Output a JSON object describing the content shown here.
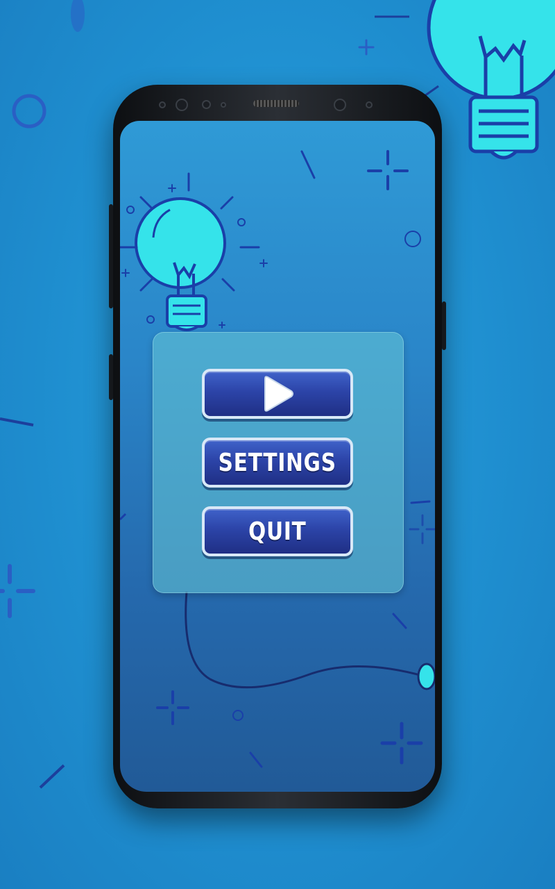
{
  "screen": "main-menu",
  "menu": {
    "play_icon": "play-icon",
    "settings_label": "SETTINGS",
    "quit_label": "QUIT"
  },
  "colors": {
    "background": "#1f8fd0",
    "screen_background": "#2a86c9",
    "panel": "#68c8d6",
    "button": "#2c44a8",
    "button_border": "#d8e8f7",
    "bulb": "#2fe0e6",
    "bulb_outline": "#1a3fa8"
  }
}
